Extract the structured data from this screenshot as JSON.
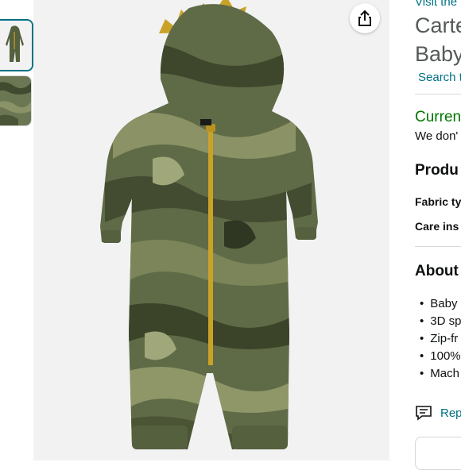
{
  "store_link": "Visit the",
  "title_line1": "Carte",
  "title_line2": "Baby",
  "search_link": "Search t",
  "availability": {
    "status": "Curren",
    "note": "We don'"
  },
  "product_section": {
    "heading": "Produ",
    "fabric_label": "Fabric ty",
    "care_label": "Care ins"
  },
  "about_section": {
    "heading": "About",
    "bullets": [
      "Baby",
      "3D sp",
      "Zip-fr",
      "100%",
      "Mach"
    ]
  },
  "report_link": "Rep",
  "icons": {
    "share": "share-icon",
    "report": "feedback-icon"
  },
  "colors": {
    "link": "#007185",
    "in_stock": "#007600",
    "selected_thumb_border": "#007185",
    "camo_base": "#5f6b47",
    "zipper": "#c9a227"
  }
}
